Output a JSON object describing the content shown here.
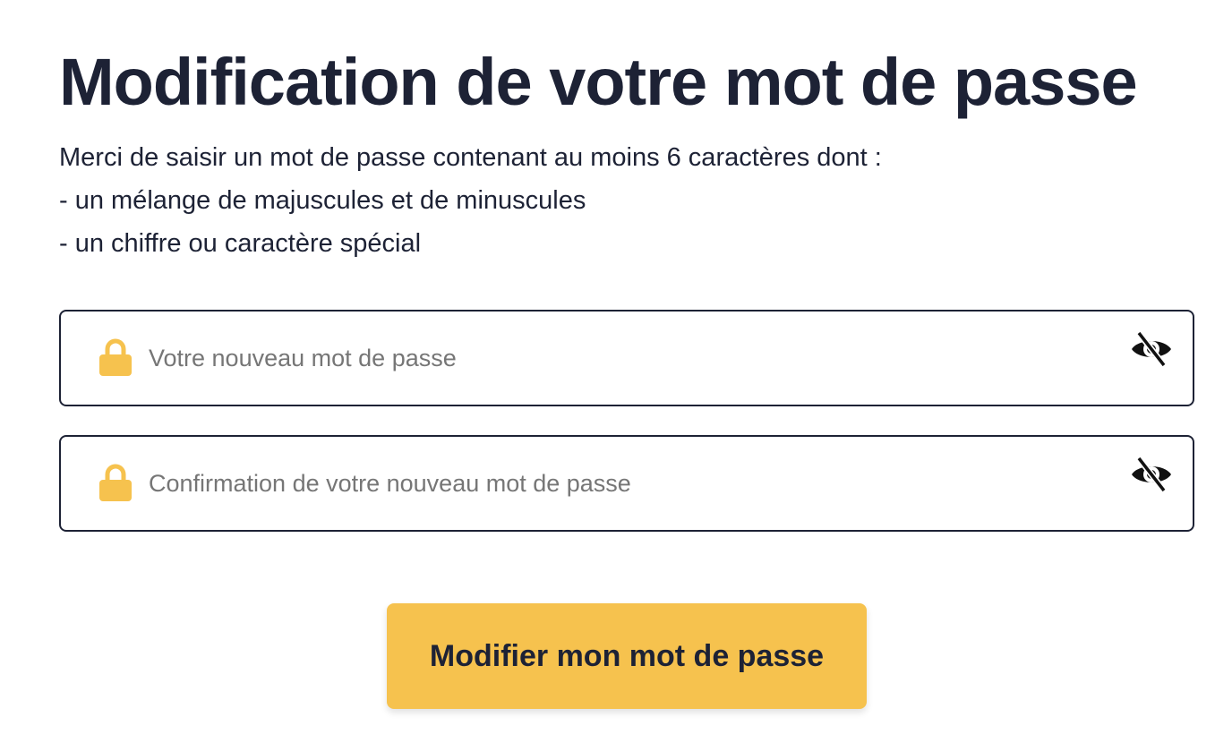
{
  "page": {
    "title": "Modification de votre mot de passe",
    "instructions": [
      "Merci de saisir un mot de passe contenant au moins 6 caractères dont :",
      "- un mélange de majuscules et de minuscules",
      "- un chiffre ou caractère spécial"
    ]
  },
  "form": {
    "new_password": {
      "value": "",
      "placeholder": "Votre nouveau mot de passe",
      "icon": "lock-icon",
      "toggle_icon": "eye-slash-icon"
    },
    "confirm_password": {
      "value": "",
      "placeholder": "Confirmation de votre nouveau mot de passe",
      "icon": "lock-icon",
      "toggle_icon": "eye-slash-icon"
    },
    "submit_label": "Modifier mon mot de passe"
  },
  "colors": {
    "text": "#1d2235",
    "accent": "#f6c24e",
    "placeholder": "#767676",
    "lock": "#f6c24e"
  }
}
